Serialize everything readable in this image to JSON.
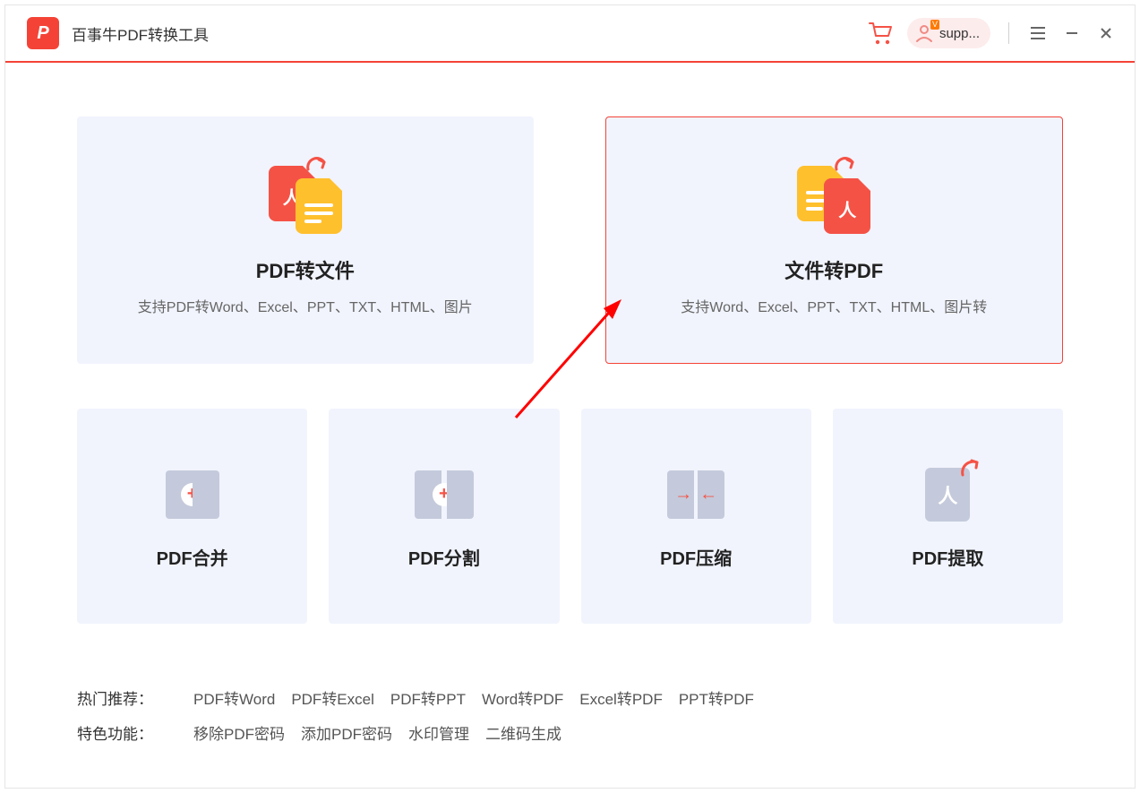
{
  "app": {
    "logo_letter": "P",
    "title": "百事牛PDF转换工具"
  },
  "titlebar": {
    "user_badge": "V",
    "user_name": "supp..."
  },
  "cards": {
    "pdf_to_file": {
      "title": "PDF转文件",
      "subtitle": "支持PDF转Word、Excel、PPT、TXT、HTML、图片"
    },
    "file_to_pdf": {
      "title": "文件转PDF",
      "subtitle": "支持Word、Excel、PPT、TXT、HTML、图片转"
    },
    "merge": {
      "title": "PDF合并"
    },
    "split": {
      "title": "PDF分割"
    },
    "compress": {
      "title": "PDF压缩"
    },
    "extract": {
      "title": "PDF提取"
    }
  },
  "footer": {
    "hot_label": "热门推荐：",
    "hot_items": [
      "PDF转Word",
      "PDF转Excel",
      "PDF转PPT",
      "Word转PDF",
      "Excel转PDF",
      "PPT转PDF"
    ],
    "feature_label": "特色功能：",
    "feature_items": [
      "移除PDF密码",
      "添加PDF密码",
      "水印管理",
      "二维码生成"
    ]
  }
}
